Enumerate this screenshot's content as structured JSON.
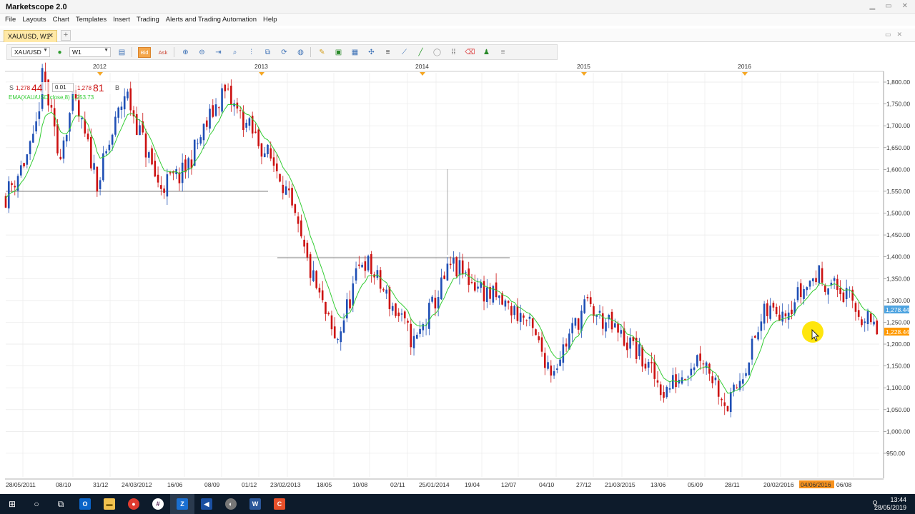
{
  "app": {
    "title": "Marketscope 2.0"
  },
  "menu": [
    "File",
    "Layouts",
    "Chart",
    "Templates",
    "Insert",
    "Trading",
    "Alerts and Trading Automation",
    "Help"
  ],
  "tab": {
    "label": "XAU/USD, W1",
    "close": "✕",
    "add": "+"
  },
  "toolbar": {
    "instrument": "XAU/USD",
    "timeframe": "W1",
    "bid_label": "Bid",
    "ask_label": "Ask"
  },
  "sell_buy": {
    "sell_label": "S",
    "sell_small": "1,278",
    "sell_big": "44",
    "amount": "0.01",
    "buy_small": "1,278",
    "buy_big": "81",
    "buy_label": "B"
  },
  "indicator": {
    "label": "EMA(XAU/USD.close,8)",
    "value": "1,253.73",
    "color": "#33cc33"
  },
  "colors": {
    "up": "#1f4fb5",
    "down": "#cc1111",
    "ema": "#33cc33",
    "bid_tag": "#4da3e0",
    "ask_tag": "#ff9900"
  },
  "price_tags": {
    "bid": "1,278.44",
    "ask": "1,228.44"
  },
  "year_labels": [
    "2012",
    "2013",
    "2014",
    "2015",
    "2016"
  ],
  "price_labels": [
    "1,800.00",
    "1,750.00",
    "1,700.00",
    "1,650.00",
    "1,600.00",
    "1,550.00",
    "1,500.00",
    "1,450.00",
    "1,400.00",
    "1,350.00",
    "1,300.00",
    "1,250.00",
    "1,200.00",
    "1,150.00",
    "1,100.00",
    "1,050.00",
    "1,000.00",
    "950.00"
  ],
  "date_labels": [
    "28/05/2011",
    "08/10",
    "31/12",
    "24/03/2012",
    "16/06",
    "08/09",
    "01/12",
    "23/02/2013",
    "18/05",
    "10/08",
    "02/11",
    "25/01/2014",
    "19/04",
    "12/07",
    "04/10",
    "27/12",
    "21/03/2015",
    "13/06",
    "05/09",
    "28/11",
    "20/02/2016",
    "04/06/2016",
    "06/08"
  ],
  "taskbar": {
    "time": "13:44",
    "date": "28/05/2019"
  },
  "chart_data": {
    "type": "candlestick",
    "instrument": "XAU/USD",
    "timeframe": "W1",
    "ylim": [
      925,
      1820
    ],
    "xlabel": "",
    "ylabel": "",
    "grid": true,
    "close_series": [
      {
        "date": "28/05/2011",
        "close": 1540
      },
      {
        "date": "01/08/2011",
        "close": 1660
      },
      {
        "date": "22/08/2011",
        "close": 1820
      },
      {
        "date": "26/09/2011",
        "close": 1630
      },
      {
        "date": "31/10/2011",
        "close": 1760
      },
      {
        "date": "26/12/2011",
        "close": 1570
      },
      {
        "date": "27/02/2012",
        "close": 1780
      },
      {
        "date": "14/05/2012",
        "close": 1560
      },
      {
        "date": "09/07/2012",
        "close": 1590
      },
      {
        "date": "08/10/2012",
        "close": 1780
      },
      {
        "date": "10/12/2012",
        "close": 1690
      },
      {
        "date": "18/02/2013",
        "close": 1590
      },
      {
        "date": "15/04/2013",
        "close": 1400
      },
      {
        "date": "24/06/2013",
        "close": 1200
      },
      {
        "date": "26/08/2013",
        "close": 1400
      },
      {
        "date": "23/12/2013",
        "close": 1200
      },
      {
        "date": "17/03/2014",
        "close": 1380
      },
      {
        "date": "16/06/2014",
        "close": 1310
      },
      {
        "date": "01/09/2014",
        "close": 1260
      },
      {
        "date": "03/11/2014",
        "close": 1140
      },
      {
        "date": "19/01/2015",
        "close": 1290
      },
      {
        "date": "11/05/2015",
        "close": 1190
      },
      {
        "date": "20/07/2015",
        "close": 1090
      },
      {
        "date": "12/10/2015",
        "close": 1180
      },
      {
        "date": "14/12/2015",
        "close": 1055
      },
      {
        "date": "07/03/2016",
        "close": 1270
      },
      {
        "date": "02/05/2016",
        "close": 1290
      },
      {
        "date": "04/07/2016",
        "close": 1360
      },
      {
        "date": "29/08/2016",
        "close": 1320
      },
      {
        "date": "14/11/2016",
        "close": 1230
      }
    ]
  }
}
